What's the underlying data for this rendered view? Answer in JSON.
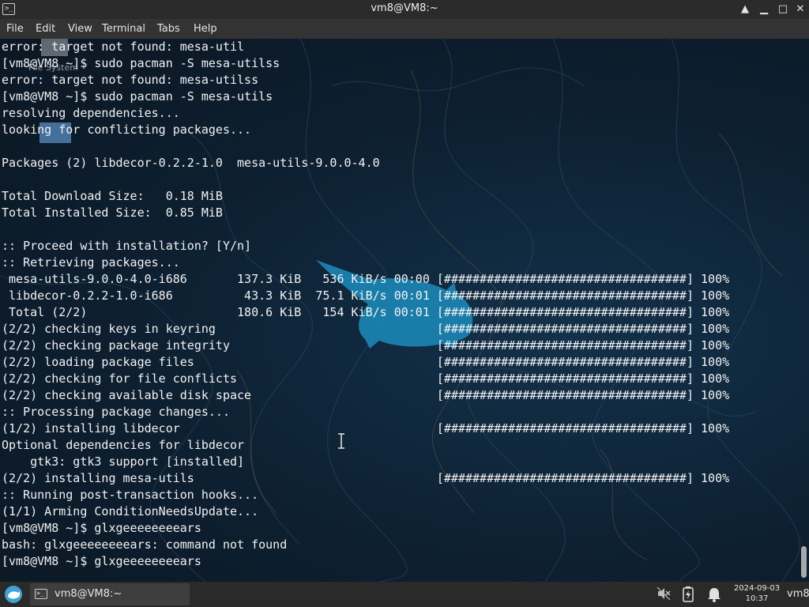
{
  "window": {
    "title": "vm8@VM8:~",
    "app_icon_glyph": ">_",
    "minimize_glyph": "▲",
    "restore_glyph": "▁",
    "maximize_glyph": "□",
    "close_glyph": "✕"
  },
  "menu": [
    "File",
    "Edit",
    "View",
    "Terminal",
    "Tabs",
    "Help"
  ],
  "desktop_icons": {
    "file_system_label": "File System"
  },
  "terminal": {
    "lines": [
      "error: target not found: mesa-util",
      "[vm8@VM8 ~]$ sudo pacman -S mesa-utilss",
      "error: target not found: mesa-utilss",
      "[vm8@VM8 ~]$ sudo pacman -S mesa-utils",
      "resolving dependencies...",
      "looking for conflicting packages...",
      "",
      "Packages (2) libdecor-0.2.2-1.0  mesa-utils-9.0.0-4.0",
      "",
      "Total Download Size:   0.18 MiB",
      "Total Installed Size:  0.85 MiB",
      "",
      ":: Proceed with installation? [Y/n]",
      ":: Retrieving packages...",
      " mesa-utils-9.0.0-4.0-i686       137.3 KiB   536 KiB/s 00:00 [##################################] 100%",
      " libdecor-0.2.2-1.0-i686          43.3 KiB  75.1 KiB/s 00:01 [##################################] 100%",
      " Total (2/2)                     180.6 KiB   154 KiB/s 00:01 [##################################] 100%",
      "(2/2) checking keys in keyring                               [##################################] 100%",
      "(2/2) checking package integrity                             [##################################] 100%",
      "(2/2) loading package files                                  [##################################] 100%",
      "(2/2) checking for file conflicts                            [##################################] 100%",
      "(2/2) checking available disk space                          [##################################] 100%",
      ":: Processing package changes...",
      "(1/2) installing libdecor                                    [##################################] 100%",
      "Optional dependencies for libdecor",
      "    gtk3: gtk3 support [installed]",
      "(2/2) installing mesa-utils                                  [##################################] 100%",
      ":: Running post-transaction hooks...",
      "(1/1) Arming ConditionNeedsUpdate...",
      "[vm8@VM8 ~]$ glxgeeeeeeeears",
      "bash: glxgeeeeeeeears: command not found",
      "[vm8@VM8 ~]$ glxgeeeeeeeears"
    ]
  },
  "taskbar": {
    "task_label": "vm8@VM8:~",
    "task_icon_glyph": ">_",
    "clock_date": "2024-09-03",
    "clock_time": "10:37",
    "user": "vm8"
  },
  "colors": {
    "terminal_text": "#f2f2f2",
    "titlebar_bg": "#2b2b2b",
    "menubar_bg": "#333333",
    "taskbar_bg": "#2a2a2a",
    "mouse_logo": "#1c86b5"
  }
}
